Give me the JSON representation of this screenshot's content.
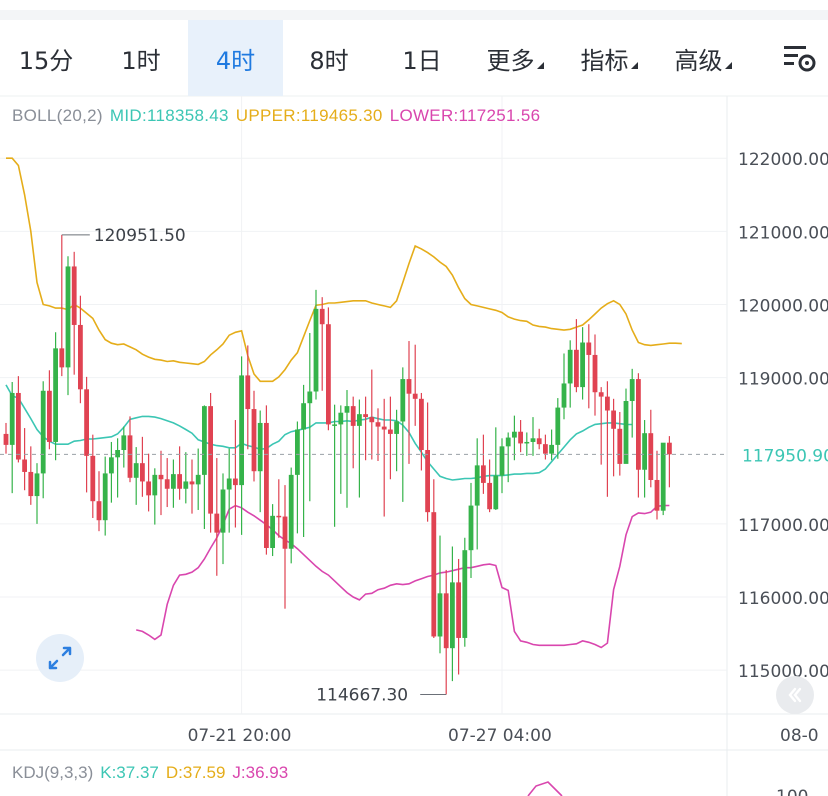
{
  "toolbar": {
    "tabs": [
      {
        "label": "15分"
      },
      {
        "label": "1时"
      },
      {
        "label": "4时",
        "active": true
      },
      {
        "label": "8时"
      },
      {
        "label": "1日"
      },
      {
        "label": "更多",
        "dropdown": true
      },
      {
        "label": "指标",
        "dropdown": true
      },
      {
        "label": "高级",
        "dropdown": true
      }
    ],
    "settings_icon": "chart-settings-icon"
  },
  "boll": {
    "name": "BOLL(20,2)",
    "mid_label": "MID:118358.43",
    "upper_label": "UPPER:119465.30",
    "lower_label": "LOWER:117251.56",
    "mid_color": "#3cc6b4",
    "upper_color": "#e5ad1a",
    "lower_color": "#d946ae"
  },
  "kdj": {
    "name": "KDJ(9,3,3)",
    "k_label": "K:37.37",
    "d_label": "D:37.59",
    "j_label": "J:36.93",
    "k_color": "#3cc6b4",
    "d_color": "#e5ad1a",
    "j_color": "#d946ae",
    "axis_partial": "100"
  },
  "colors": {
    "up": "#35b34a",
    "down": "#e04352",
    "accent": "#1f7ae0"
  },
  "chart_data": {
    "type": "candlestick",
    "y_ticks": [
      "122000.00",
      "121000.00",
      "120000.00",
      "119000.00",
      "117000.00",
      "116000.00",
      "115000.00"
    ],
    "y_tick_values": [
      122000,
      121000,
      120000,
      119000,
      117000,
      116000,
      115000
    ],
    "ylim": [
      114400,
      122550
    ],
    "current_price": "117950.90",
    "current_value": 117950.9,
    "x_ticks": [
      "07-21 20:00",
      "07-27 04:00",
      "08-0"
    ],
    "x_tick_indices": [
      38,
      80,
      117
    ],
    "high_annotation": {
      "label": "120951.50",
      "value": 120951.5,
      "index": 9
    },
    "low_annotation": {
      "label": "114667.30",
      "value": 114667.3,
      "index": 71
    },
    "candles": [
      [
        118230,
        118380,
        117960,
        118080
      ],
      [
        118080,
        118940,
        117420,
        118790
      ],
      [
        118790,
        119020,
        117840,
        117880
      ],
      [
        117880,
        118310,
        117460,
        117710
      ],
      [
        117710,
        118060,
        117260,
        117380
      ],
      [
        117380,
        117830,
        117000,
        117690
      ],
      [
        117690,
        118950,
        117350,
        118820
      ],
      [
        118820,
        119100,
        118020,
        118120
      ],
      [
        118120,
        119620,
        117870,
        119400
      ],
      [
        119400,
        120951.5,
        119020,
        119140
      ],
      [
        119140,
        120660,
        118760,
        120520
      ],
      [
        120520,
        120720,
        119040,
        119720
      ],
      [
        119720,
        120120,
        118650,
        118840
      ],
      [
        118840,
        119010,
        117430,
        117930
      ],
      [
        117930,
        118220,
        117080,
        117310
      ],
      [
        117310,
        117720,
        116900,
        117050
      ],
      [
        117050,
        117920,
        116840,
        117690
      ],
      [
        117690,
        118120,
        117290,
        117910
      ],
      [
        117910,
        118170,
        117360,
        118010
      ],
      [
        118010,
        118330,
        117770,
        118210
      ],
      [
        118210,
        118470,
        117570,
        117630
      ],
      [
        117630,
        118050,
        117260,
        117830
      ],
      [
        117830,
        118190,
        117370,
        117580
      ],
      [
        117580,
        117960,
        117170,
        117390
      ],
      [
        117390,
        117760,
        116990,
        117670
      ],
      [
        117670,
        118000,
        117120,
        117610
      ],
      [
        117610,
        117900,
        117230,
        117480
      ],
      [
        117480,
        117880,
        117220,
        117680
      ],
      [
        117680,
        118060,
        117330,
        117480
      ],
      [
        117480,
        117980,
        117280,
        117580
      ],
      [
        117580,
        117880,
        117140,
        117540
      ],
      [
        117540,
        118030,
        117190,
        117670
      ],
      [
        117670,
        118620,
        116930,
        118610
      ],
      [
        118610,
        118790,
        116880,
        117140
      ],
      [
        117140,
        117900,
        116290,
        116880
      ],
      [
        116880,
        117690,
        116450,
        117470
      ],
      [
        117470,
        118030,
        116880,
        117620
      ],
      [
        117620,
        118420,
        116950,
        117530
      ],
      [
        117530,
        119290,
        116850,
        119030
      ],
      [
        119030,
        119440,
        118020,
        118570
      ],
      [
        118570,
        118820,
        117580,
        117720
      ],
      [
        117720,
        118550,
        117160,
        118380
      ],
      [
        118380,
        118620,
        116580,
        116670
      ],
      [
        116670,
        117270,
        116560,
        117110
      ],
      [
        117110,
        117610,
        116810,
        117100
      ],
      [
        117100,
        117530,
        115840,
        116660
      ],
      [
        116660,
        117770,
        116460,
        117670
      ],
      [
        117670,
        118400,
        116870,
        118290
      ],
      [
        118290,
        118900,
        116820,
        118650
      ],
      [
        118650,
        119610,
        117310,
        118810
      ],
      [
        118810,
        120200,
        118700,
        119940
      ],
      [
        119940,
        120100,
        118820,
        119730
      ],
      [
        119730,
        119960,
        118280,
        118360
      ],
      [
        118360,
        118630,
        116960,
        118360
      ],
      [
        118360,
        118620,
        117410,
        118520
      ],
      [
        118520,
        118830,
        117220,
        118610
      ],
      [
        118610,
        118740,
        117760,
        118340
      ],
      [
        118340,
        118700,
        117360,
        118500
      ],
      [
        118500,
        118740,
        117870,
        118460
      ],
      [
        118460,
        119110,
        117880,
        118390
      ],
      [
        118390,
        118580,
        117860,
        118330
      ],
      [
        118330,
        118710,
        117100,
        118290
      ],
      [
        118290,
        118740,
        117610,
        118230
      ],
      [
        118230,
        118560,
        117720,
        118400
      ],
      [
        118400,
        119140,
        117300,
        118980
      ],
      [
        118980,
        119500,
        117820,
        118780
      ],
      [
        118780,
        119450,
        118340,
        118710
      ],
      [
        118710,
        118790,
        117730,
        118010
      ],
      [
        118010,
        118660,
        117030,
        117160
      ],
      [
        117160,
        117610,
        115440,
        115460
      ],
      [
        115460,
        116840,
        115230,
        116050
      ],
      [
        116050,
        116370,
        114667.3,
        115300
      ],
      [
        115300,
        116690,
        114850,
        116200
      ],
      [
        116200,
        116520,
        114940,
        115440
      ],
      [
        115440,
        116810,
        115320,
        116640
      ],
      [
        116640,
        117560,
        116260,
        117250
      ],
      [
        117250,
        118170,
        116650,
        117800
      ],
      [
        117800,
        118220,
        117410,
        117560
      ],
      [
        117560,
        117880,
        117160,
        117200
      ],
      [
        117200,
        118320,
        117190,
        117660
      ],
      [
        117660,
        118170,
        117420,
        118060
      ],
      [
        118060,
        118250,
        117570,
        118180
      ],
      [
        118180,
        118480,
        117870,
        118260
      ],
      [
        118260,
        118420,
        117980,
        118100
      ],
      [
        118100,
        118250,
        117930,
        118120
      ],
      [
        118120,
        118460,
        117930,
        118170
      ],
      [
        118170,
        118300,
        118020,
        118090
      ],
      [
        118090,
        118220,
        117880,
        117960
      ],
      [
        117960,
        118290,
        117870,
        118080
      ],
      [
        118080,
        118720,
        117890,
        118590
      ],
      [
        118590,
        119330,
        118430,
        118920
      ],
      [
        118920,
        119510,
        118590,
        119380
      ],
      [
        119380,
        119800,
        118800,
        118870
      ],
      [
        118870,
        119690,
        118700,
        119480
      ],
      [
        119480,
        119730,
        118580,
        119310
      ],
      [
        119310,
        119590,
        118480,
        118800
      ],
      [
        118800,
        118870,
        117810,
        118740
      ],
      [
        118740,
        118950,
        117370,
        118550
      ],
      [
        118550,
        118710,
        117650,
        118300
      ],
      [
        118300,
        118530,
        117660,
        117820
      ],
      [
        117820,
        118850,
        117860,
        118680
      ],
      [
        118680,
        119120,
        118180,
        118980
      ],
      [
        118980,
        119060,
        117360,
        117740
      ],
      [
        117740,
        118420,
        117360,
        118240
      ],
      [
        118240,
        118560,
        117500,
        117600
      ],
      [
        117600,
        118000,
        117060,
        117180
      ],
      [
        117180,
        118020,
        117120,
        118110
      ],
      [
        118110,
        118200,
        117500,
        117950.9
      ]
    ],
    "upper_band": [
      122000,
      122000,
      121900,
      121500,
      121000,
      120300,
      120000,
      119980,
      119950,
      119950,
      119930,
      120000,
      119950,
      119880,
      119810,
      119650,
      119520,
      119470,
      119450,
      119460,
      119420,
      119380,
      119320,
      119280,
      119250,
      119240,
      119220,
      119230,
      119210,
      119200,
      119190,
      119180,
      119220,
      119310,
      119380,
      119460,
      119580,
      119620,
      119640,
      119300,
      119050,
      118950,
      118950,
      118950,
      119010,
      119110,
      119240,
      119340,
      119560,
      119780,
      119990,
      120000,
      120020,
      120020,
      120030,
      120040,
      120050,
      120050,
      120050,
      120020,
      120000,
      119980,
      119960,
      120050,
      120300,
      120560,
      120800,
      120760,
      120710,
      120650,
      120580,
      120520,
      120400,
      120230,
      120080,
      120000,
      119980,
      119960,
      119940,
      119920,
      119890,
      119830,
      119800,
      119780,
      119770,
      119720,
      119700,
      119690,
      119670,
      119660,
      119650,
      119660,
      119690,
      119720,
      119790,
      119870,
      119950,
      120010,
      120050,
      120000,
      119870,
      119650,
      119480,
      119450,
      119440,
      119450,
      119460,
      119470,
      119470,
      119465.3
    ],
    "mid_band": [
      118900,
      118750,
      118720,
      118580,
      118440,
      118290,
      118190,
      118130,
      118090,
      118090,
      118090,
      118130,
      118140,
      118160,
      118160,
      118170,
      118180,
      118190,
      118230,
      118320,
      118430,
      118450,
      118470,
      118470,
      118460,
      118440,
      118410,
      118380,
      118340,
      118290,
      118240,
      118150,
      118120,
      118090,
      118070,
      118060,
      118040,
      118040,
      118100,
      118070,
      118050,
      118020,
      118030,
      118090,
      118130,
      118220,
      118260,
      118280,
      118300,
      118320,
      118380,
      118380,
      118380,
      118400,
      118400,
      118410,
      118400,
      118420,
      118430,
      118460,
      118440,
      118420,
      118420,
      118410,
      118350,
      118250,
      118100,
      117980,
      117850,
      117750,
      117650,
      117620,
      117600,
      117610,
      117620,
      117620,
      117630,
      117650,
      117660,
      117660,
      117660,
      117670,
      117680,
      117680,
      117690,
      117690,
      117700,
      117750,
      117850,
      117950,
      118050,
      118150,
      118230,
      118270,
      118320,
      118360,
      118370,
      118380,
      118380,
      118370,
      118360,
      118358.43
    ],
    "lower_band": [
      115550,
      115530,
      115480,
      115420,
      115480,
      115900,
      116160,
      116300,
      116310,
      116340,
      116400,
      116520,
      116670,
      116810,
      116990,
      117200,
      117250,
      117220,
      117160,
      117110,
      117050,
      116990,
      116920,
      116840,
      116780,
      116730,
      116660,
      116580,
      116500,
      116420,
      116350,
      116300,
      116220,
      116140,
      116060,
      116000,
      115960,
      116040,
      116050,
      116100,
      116120,
      116160,
      116180,
      116170,
      116180,
      116220,
      116250,
      116280,
      116300,
      116330,
      116340,
      116360,
      116380,
      116400,
      116400,
      116420,
      116440,
      116450,
      116430,
      116130,
      116090,
      115530,
      115400,
      115380,
      115350,
      115340,
      115340,
      115340,
      115340,
      115340,
      115350,
      115360,
      115400,
      115380,
      115350,
      115310,
      115370,
      116100,
      116420,
      116850,
      117100,
      117150,
      117140,
      117160,
      117240,
      117250,
      117251.56
    ]
  }
}
